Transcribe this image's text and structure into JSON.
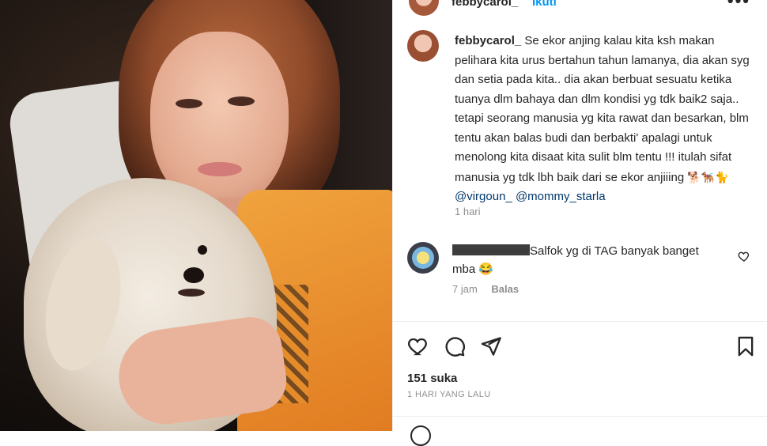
{
  "post": {
    "username": "febbycarol_",
    "follow_label": "Ikuti",
    "more_label": "•••"
  },
  "caption": {
    "username": "febbycarol_",
    "text": "Se ekor anjing kalau kita ksh makan pelihara kita urus bertahun tahun lamanya, dia akan syg dan setia pada kita.. dia akan berbuat sesuatu ketika tuanya dlm bahaya dan dlm kondisi yg tdk baik2 saja.. tetapi seorang manusia yg kita rawat dan besarkan, blm tentu akan balas budi dan berbakti' apalagi untuk menolong kita disaat kita sulit blm tentu !!! itulah sifat manusia yg tdk lbh baik dari se ekor anjiiing",
    "emojis": "🐕🐕‍🦺🐈",
    "mention1": "@virgoun_",
    "mention2": "@mommy_starla",
    "time": "1 hari"
  },
  "reply": {
    "text": "Salfok yg di TAG banyak banget mba 😂",
    "time": "7 jam",
    "reply_label": "Balas"
  },
  "stats": {
    "likes": "151 suka",
    "date": "1 HARI YANG LALU"
  },
  "icons": {
    "like": "heart-icon",
    "comment": "comment-icon",
    "share": "send-icon",
    "save": "bookmark-icon"
  }
}
